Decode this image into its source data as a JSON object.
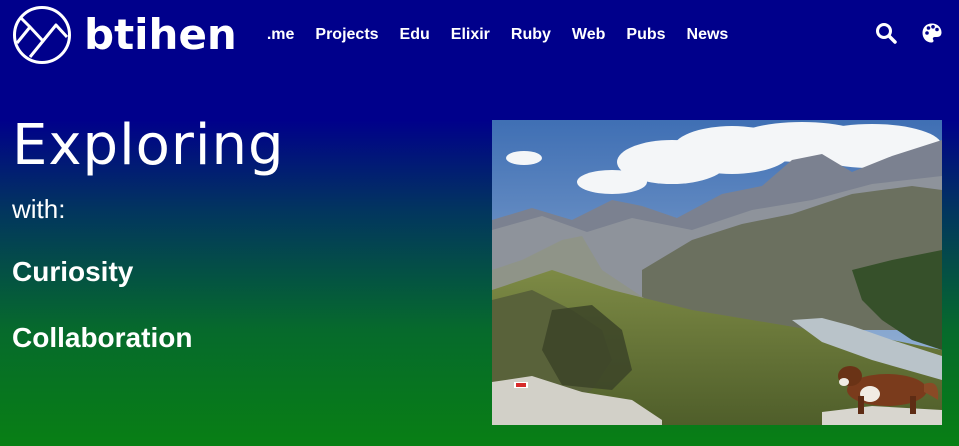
{
  "brand": {
    "name": "btihen",
    "logo_icon": "mountain-logo-icon"
  },
  "nav": {
    "links": [
      ".me",
      "Projects",
      "Edu",
      "Elixir",
      "Ruby",
      "Web",
      "Pubs",
      "News"
    ],
    "icons": [
      "search-icon",
      "palette-icon"
    ]
  },
  "hero": {
    "title": "Exploring",
    "subtitle": "with:",
    "values": [
      "Curiosity",
      "Collaboration"
    ],
    "image": "mountain-landscape-with-dog-photo"
  },
  "colors": {
    "header_bg": "#00008b",
    "gradient_bottom": "#087f14",
    "text": "#ffffff"
  }
}
